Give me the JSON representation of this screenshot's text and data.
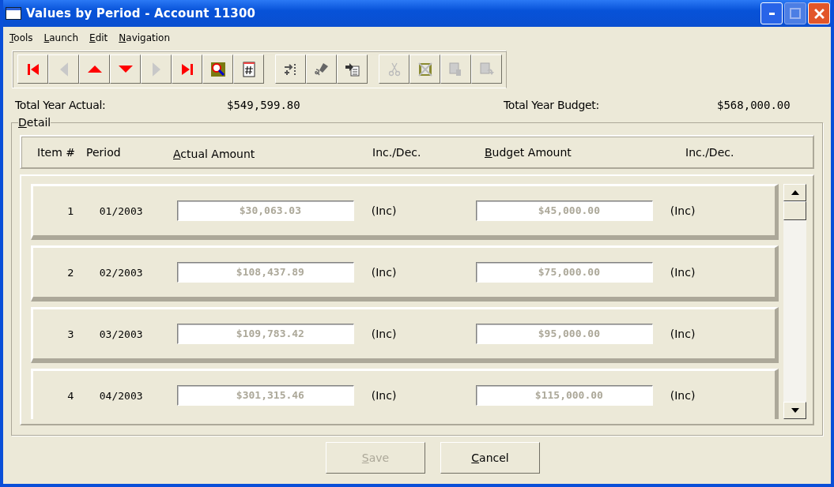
{
  "window": {
    "title": "Values by Period - Account 11300"
  },
  "menu": [
    {
      "mnemonic": "T",
      "rest": "ools"
    },
    {
      "mnemonic": "L",
      "rest": "aunch"
    },
    {
      "mnemonic": "E",
      "rest": "dit"
    },
    {
      "mnemonic": "N",
      "rest": "avigation"
    }
  ],
  "toolbar": [
    [
      {
        "kind": "first",
        "disabled": false
      },
      {
        "kind": "prev",
        "disabled": true
      },
      {
        "kind": "up",
        "disabled": false
      },
      {
        "kind": "down",
        "disabled": false
      },
      {
        "kind": "next",
        "disabled": true
      },
      {
        "kind": "last",
        "disabled": false
      },
      {
        "kind": "find",
        "disabled": false
      },
      {
        "kind": "number",
        "disabled": false
      }
    ],
    [
      {
        "kind": "insert",
        "disabled": false
      },
      {
        "kind": "erase",
        "disabled": false
      },
      {
        "kind": "import",
        "disabled": false
      }
    ],
    [
      {
        "kind": "cut",
        "disabled": true
      },
      {
        "kind": "delete",
        "disabled": true
      },
      {
        "kind": "copy",
        "disabled": true
      },
      {
        "kind": "paste",
        "disabled": true
      }
    ]
  ],
  "totals": {
    "actual_label": "Total Year Actual:",
    "actual_value": "$549,599.80",
    "budget_label": "Total Year Budget:",
    "budget_value": "$568,000.00"
  },
  "detail": {
    "group": {
      "mnemonic": "D",
      "rest": "etail"
    },
    "columns": [
      {
        "text": "Item #"
      },
      {
        "text": "Period"
      },
      {
        "mnemonic": "A",
        "rest": "ctual Amount"
      },
      {
        "text": "Inc./Dec."
      },
      {
        "mnemonic": "B",
        "rest": "udget Amount"
      },
      {
        "text": "Inc./Dec."
      }
    ],
    "rows": [
      {
        "item": "1",
        "period": "01/2003",
        "actual": "$30,063.03",
        "actual_change": "(Inc)",
        "budget": "$45,000.00",
        "budget_change": "(Inc)",
        "disabled": true
      },
      {
        "item": "2",
        "period": "02/2003",
        "actual": "$108,437.89",
        "actual_change": "(Inc)",
        "budget": "$75,000.00",
        "budget_change": "(Inc)",
        "disabled": true
      },
      {
        "item": "3",
        "period": "03/2003",
        "actual": "$109,783.42",
        "actual_change": "(Inc)",
        "budget": "$95,000.00",
        "budget_change": "(Inc)",
        "disabled": true
      },
      {
        "item": "4",
        "period": "04/2003",
        "actual": "$301,315.46",
        "actual_change": "(Inc)",
        "budget": "$115,000.00",
        "budget_change": "(Inc)",
        "disabled": true
      }
    ]
  },
  "buttons": [
    {
      "mnemonic": "S",
      "rest": "ave",
      "disabled": true
    },
    {
      "mnemonic": "C",
      "rest": "ancel",
      "disabled": false
    }
  ]
}
